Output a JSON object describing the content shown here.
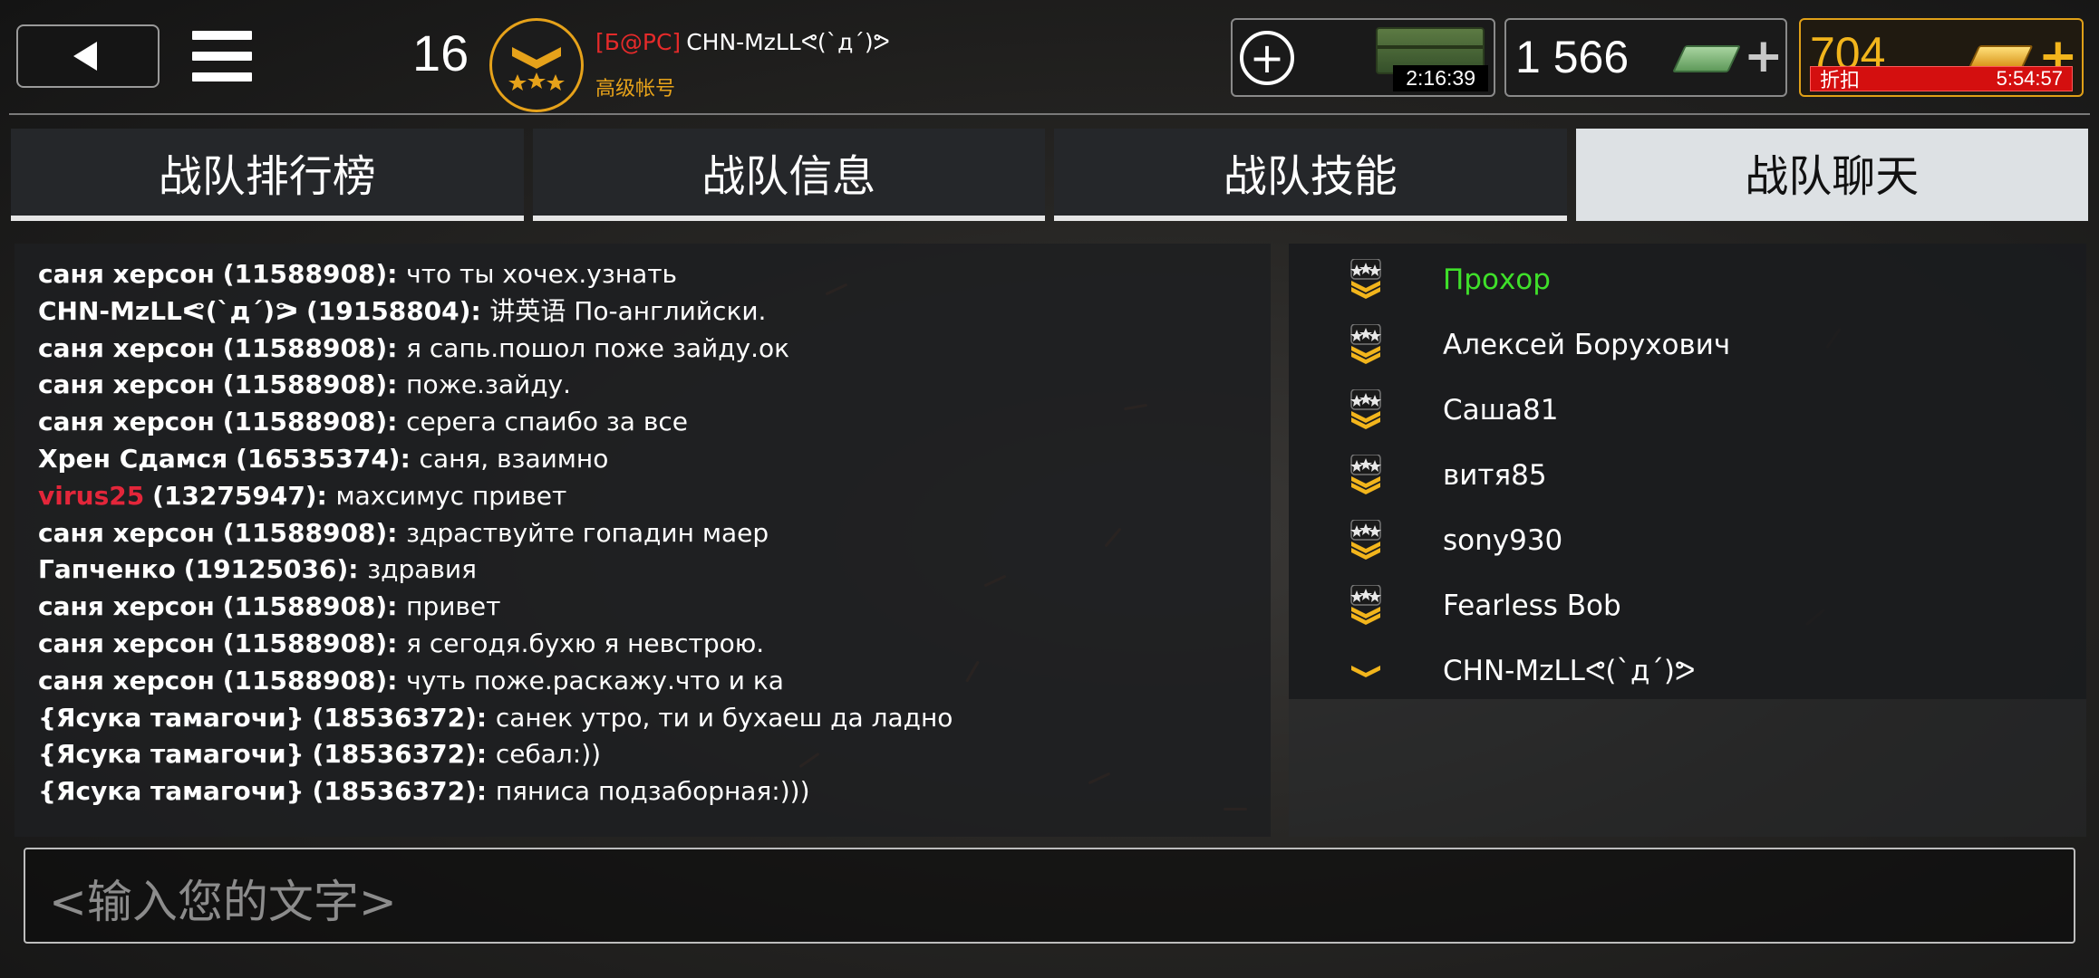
{
  "header": {
    "level": "16",
    "clan_tag": "[Б@РС]",
    "player_name": "CHN-MzLLᕙ(`д´)ᕗ",
    "account_type": "高级帐号",
    "crate_timer": "2:16:39",
    "cash": "1 566",
    "gold": "704",
    "discount_label": "折扣",
    "discount_timer": "5:54:57"
  },
  "icons": {
    "back": "back-arrow-icon",
    "menu": "hamburger-menu-icon",
    "rank": "rank-chevron-stars-icon",
    "crate": "supply-crate-icon",
    "cash": "cash-bundle-icon",
    "gold": "gold-bar-icon",
    "plus": "plus-icon"
  },
  "colors": {
    "accent_gold": "#e6a21a",
    "online_green": "#3fe02a",
    "clan_tag_red": "#e52a2a",
    "discount_red": "#d40f0f"
  },
  "tabs": [
    {
      "label": "战队排行榜",
      "active": false
    },
    {
      "label": "战队信息",
      "active": false
    },
    {
      "label": "战队技能",
      "active": false
    },
    {
      "label": "战队聊天",
      "active": true
    }
  ],
  "chat": {
    "messages": [
      {
        "author": "саня херсон",
        "id": "(11588908)",
        "text": "что ты хочех.узнать",
        "author_style": "bold"
      },
      {
        "author": "CHN-MzLLᕙ(`д´)ᕗ",
        "id": "(19158804)",
        "text": "讲英语 По-английски.",
        "author_style": "bold"
      },
      {
        "author": "саня херсон",
        "id": "(11588908)",
        "text": "я сапь.пошол поже зайду.ок",
        "author_style": "bold"
      },
      {
        "author": "саня херсон",
        "id": "(11588908)",
        "text": "поже.зайду.",
        "author_style": "bold"
      },
      {
        "author": "саня херсон",
        "id": "(11588908)",
        "text": "серега спаибо за все",
        "author_style": "bold"
      },
      {
        "author": "Хрен Сдамся",
        "id": "(16535374)",
        "text": "саня, взаимно",
        "author_style": "bold"
      },
      {
        "author": "virus25",
        "id": "(13275947)",
        "text": "махсимус привет",
        "author_style": "red"
      },
      {
        "author": "саня херсон",
        "id": "(11588908)",
        "text": "здраствуйте гопадин маер",
        "author_style": "bold"
      },
      {
        "author": "Гапченко",
        "id": "(19125036)",
        "text": "здравия",
        "author_style": "bold"
      },
      {
        "author": "саня херсон",
        "id": "(11588908)",
        "text": "привет",
        "author_style": "bold"
      },
      {
        "author": "саня херсон",
        "id": "(11588908)",
        "text": "я сегодя.бухю я невстрою.",
        "author_style": "bold"
      },
      {
        "author": "саня херсон",
        "id": "(11588908)",
        "text": "чуть поже.раскажу.что и ка",
        "author_style": "bold"
      },
      {
        "author": "{Ясука тамагочи}",
        "id": "(18536372)",
        "text": "санек утро, ти и бухаеш да ладно",
        "author_style": "bold"
      },
      {
        "author": "{Ясука тамагочи}",
        "id": "(18536372)",
        "text": "себал:))",
        "author_style": "bold"
      },
      {
        "author": "{Ясука тамагочи}",
        "id": "(18536372)",
        "text": "пяниса подзаборная:)))",
        "author_style": "bold"
      }
    ],
    "input_placeholder": "<输入您的文字>"
  },
  "members": [
    {
      "name": "Прохор",
      "online": true,
      "rank_icon": "rank-star-chevron-icon"
    },
    {
      "name": "Алексей Борухович",
      "online": false,
      "rank_icon": "rank-star-chevron-icon"
    },
    {
      "name": "Саша81",
      "online": false,
      "rank_icon": "rank-star-chevron-icon"
    },
    {
      "name": "витя85",
      "online": false,
      "rank_icon": "rank-star-chevron-icon"
    },
    {
      "name": "sony930",
      "online": false,
      "rank_icon": "rank-star-chevron-icon"
    },
    {
      "name": "Fearless Bob",
      "online": false,
      "rank_icon": "rank-star-chevron-icon"
    },
    {
      "name": "CHN-MzLLᕙ(`д´)ᕗ",
      "online": false,
      "rank_icon": "rank-chevron-icon"
    }
  ]
}
